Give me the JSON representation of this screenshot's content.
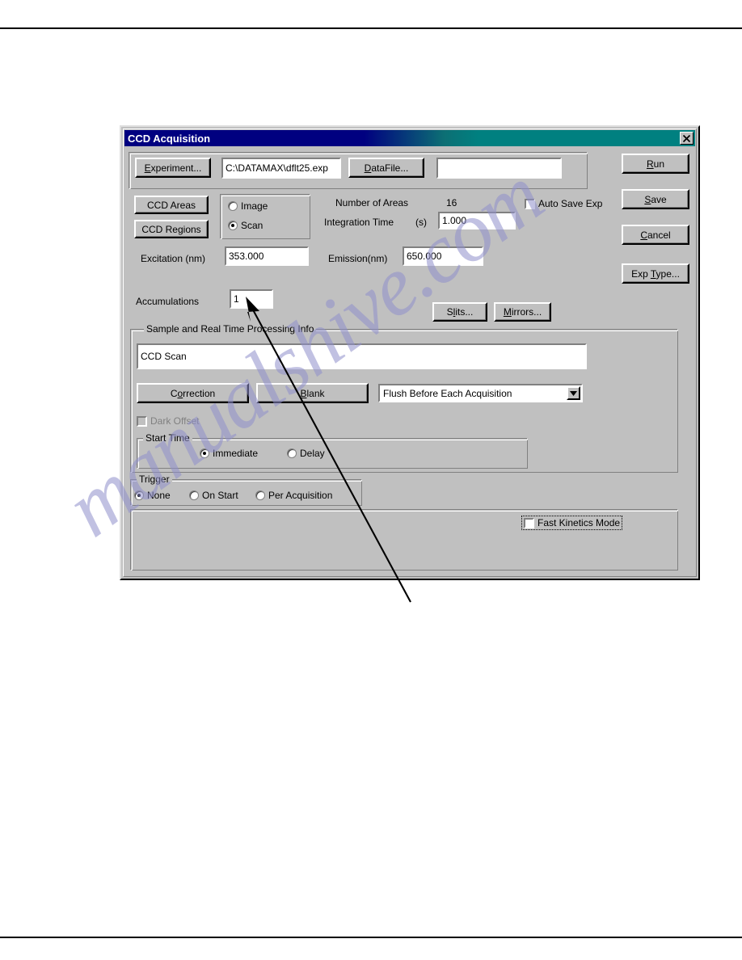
{
  "window": {
    "title": "CCD Acquisition",
    "close_icon": "close-icon"
  },
  "toolbar_top": {
    "experiment_button": "Experiment...",
    "experiment_button_accel": "E",
    "experiment_path": "C:\\DATAMAX\\dflt25.exp",
    "datafile_button": "DataFile...",
    "datafile_button_accel": "D",
    "datafile_value": ""
  },
  "right_buttons": {
    "run": "Run",
    "run_accel": "R",
    "save": "Save",
    "save_accel": "S",
    "cancel": "Cancel",
    "cancel_accel": "C",
    "exp_type": "Exp Type...",
    "exp_type_accel": "T"
  },
  "ccd": {
    "areas_button": "CCD Areas",
    "regions_button": "CCD Regions"
  },
  "mode_group": {
    "options": [
      {
        "label": "Image",
        "selected": false
      },
      {
        "label": "Scan",
        "selected": true
      }
    ]
  },
  "areas": {
    "number_of_areas_label": "Number of Areas",
    "number_of_areas_value": "16",
    "integration_time_label": "Integration Time",
    "integration_time_units": "(s)",
    "integration_time_value": "1.000"
  },
  "auto_save": {
    "label": "Auto Save Exp",
    "checked": false
  },
  "wavelengths": {
    "excitation_label": "Excitation (nm)",
    "excitation_value": "353.000",
    "emission_label": "Emission(nm)",
    "emission_value": "650.000"
  },
  "accumulations": {
    "label": "Accumulations",
    "value": "1"
  },
  "optics_buttons": {
    "slits": "Slits...",
    "slits_accel": "l",
    "mirrors": "Mirrors...",
    "mirrors_accel": "M"
  },
  "sample_group": {
    "title": "Sample and Real Time Processing Info",
    "description_value": "CCD Scan",
    "correction_button": "Correction",
    "correction_accel": "o",
    "blank_button": "Blank",
    "blank_accel": "B",
    "flush_selected": "Flush Before Each Acquisition",
    "flush_dropdown_icon": "chevron-down-icon",
    "dark_offset": {
      "label": "Dark Offset",
      "checked": false,
      "disabled": true
    },
    "start_time": {
      "title": "Start Time",
      "options": [
        {
          "label": "Immediate",
          "selected": true
        },
        {
          "label": "Delay",
          "selected": false
        }
      ]
    }
  },
  "trigger_group": {
    "title": "Trigger",
    "options": [
      {
        "label": "None",
        "selected": true
      },
      {
        "label": "On Start",
        "selected": false
      },
      {
        "label": "Per Acquisition",
        "selected": false
      }
    ]
  },
  "bottom_panel": {
    "fast_kinetics": {
      "label": "Fast Kinetics Mode",
      "checked": false
    }
  },
  "annotation": {
    "type": "callout-arrow",
    "points_to": "accumulations-field"
  },
  "watermark": {
    "text": "manualshive.com",
    "color": "#8f8fcb"
  }
}
